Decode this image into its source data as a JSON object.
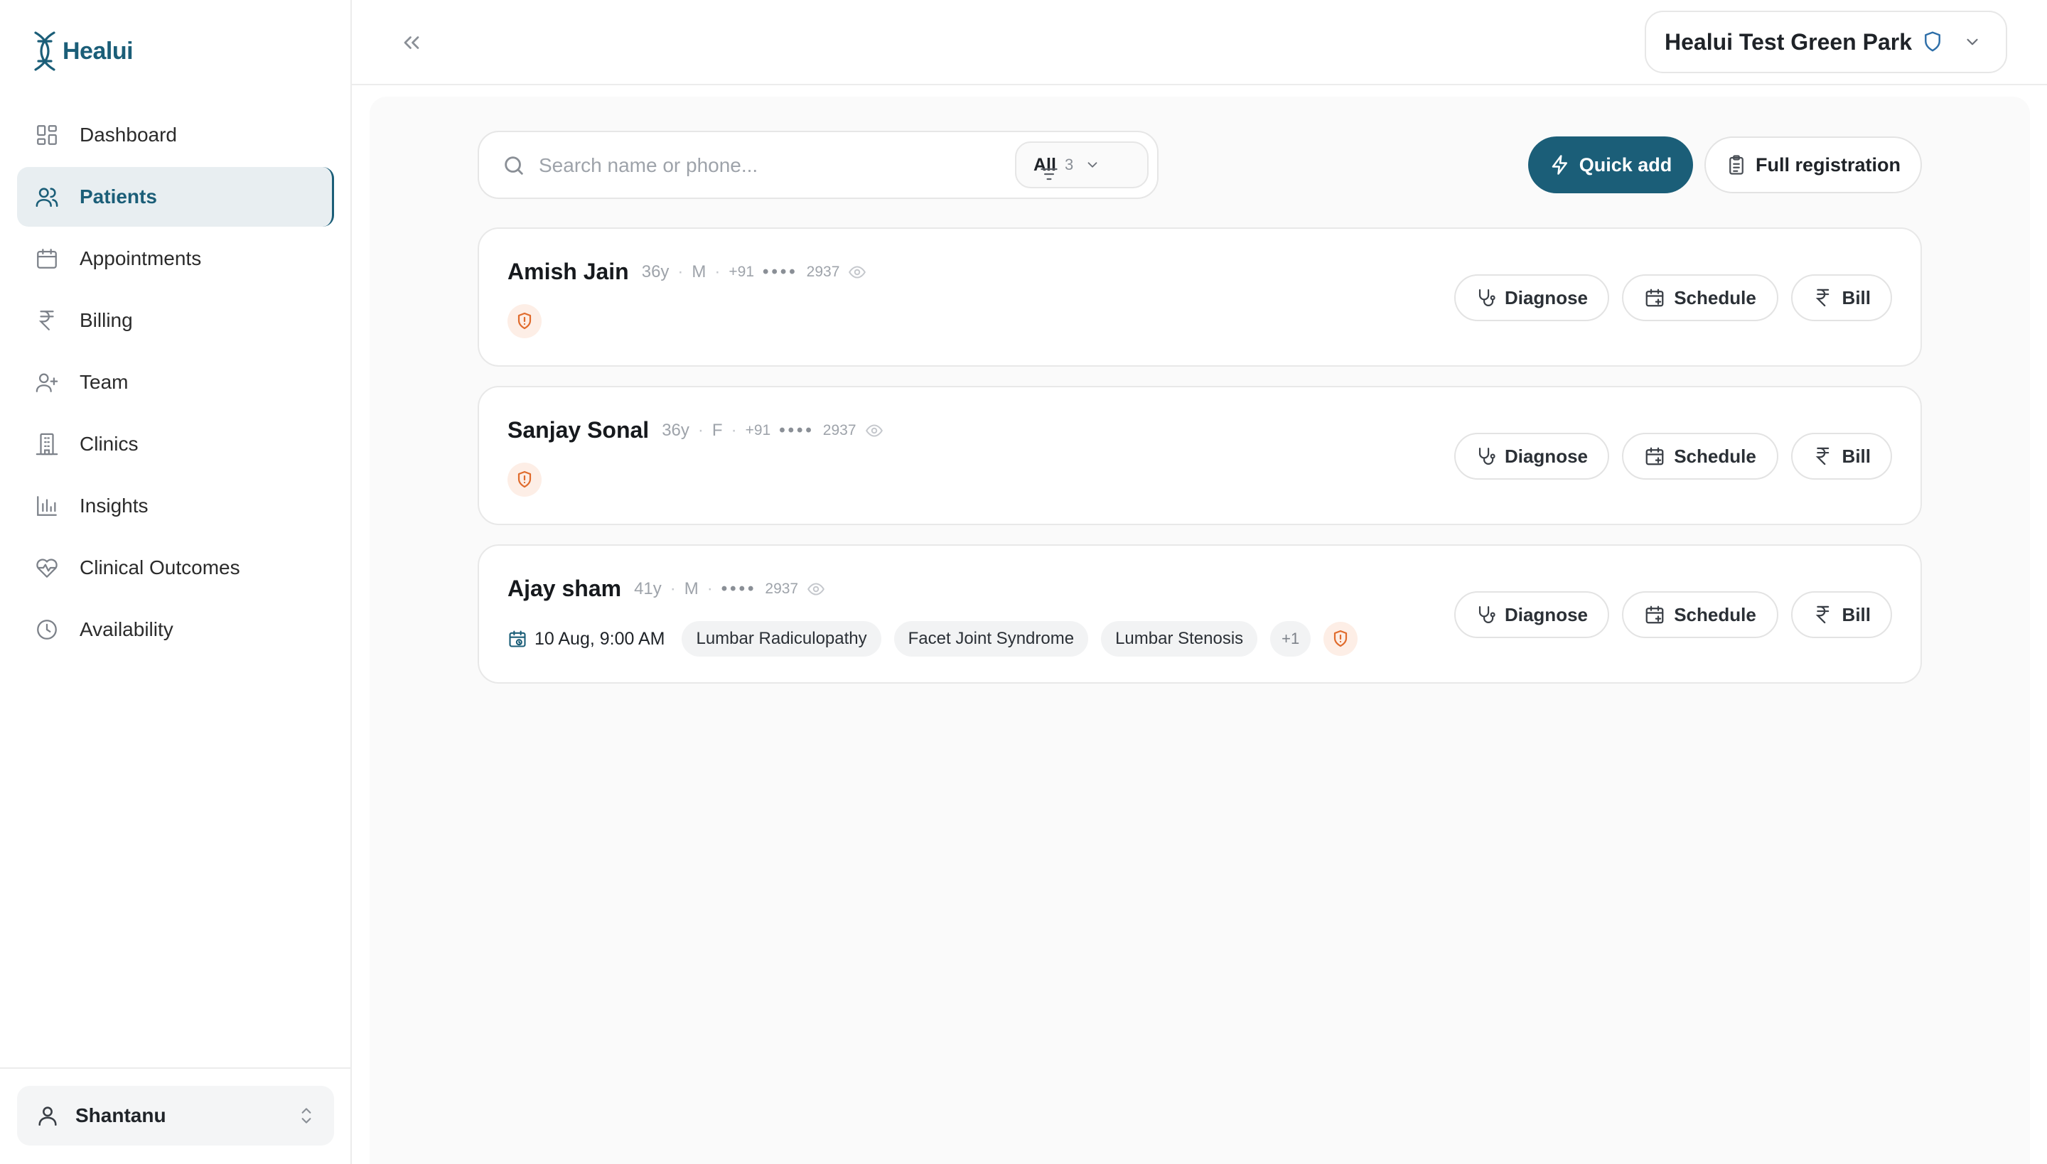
{
  "brand": {
    "name": "Healui",
    "color": "#1b5e78"
  },
  "sidebar": {
    "items": [
      {
        "label": "Dashboard",
        "icon": "grid-icon",
        "active": false
      },
      {
        "label": "Patients",
        "icon": "users-icon",
        "active": true
      },
      {
        "label": "Appointments",
        "icon": "calendar-icon",
        "active": false
      },
      {
        "label": "Billing",
        "icon": "rupee-icon",
        "active": false
      },
      {
        "label": "Team",
        "icon": "user-plus-icon",
        "active": false
      },
      {
        "label": "Clinics",
        "icon": "building-icon",
        "active": false
      },
      {
        "label": "Insights",
        "icon": "bar-chart-icon",
        "active": false
      },
      {
        "label": "Clinical Outcomes",
        "icon": "heart-pulse-icon",
        "active": false
      },
      {
        "label": "Availability",
        "icon": "clock-icon",
        "active": false
      }
    ],
    "user": {
      "name": "Shantanu"
    }
  },
  "topbar": {
    "clinic_name": "Healui Test Green Park"
  },
  "toolbar": {
    "search_placeholder": "Search name or phone...",
    "filter_label": "All",
    "filter_count": "3",
    "quick_add_label": "Quick add",
    "full_registration_label": "Full registration"
  },
  "patients": [
    {
      "name": "Amish Jain",
      "age": "36y",
      "sex": "M",
      "country_code": "+91",
      "masked": "••••",
      "phone_last4": "2937",
      "appointment": "",
      "tags": [],
      "more": ""
    },
    {
      "name": "Sanjay Sonal",
      "age": "36y",
      "sex": "F",
      "country_code": "+91",
      "masked": "••••",
      "phone_last4": "2937",
      "appointment": "",
      "tags": [],
      "more": ""
    },
    {
      "name": "Ajay sham",
      "age": "41y",
      "sex": "M",
      "country_code": "",
      "masked": "••••",
      "phone_last4": "2937",
      "appointment": "10 Aug, 9:00 AM",
      "tags": [
        "Lumbar Radiculopathy",
        "Facet Joint Syndrome",
        "Lumbar Stenosis"
      ],
      "more": "+1"
    }
  ],
  "row_actions": {
    "diagnose": "Diagnose",
    "schedule": "Schedule",
    "bill": "Bill"
  },
  "colors": {
    "primary": "#1b5e78",
    "alert": "#e06b2c",
    "alert_bg": "#fdeee6"
  }
}
